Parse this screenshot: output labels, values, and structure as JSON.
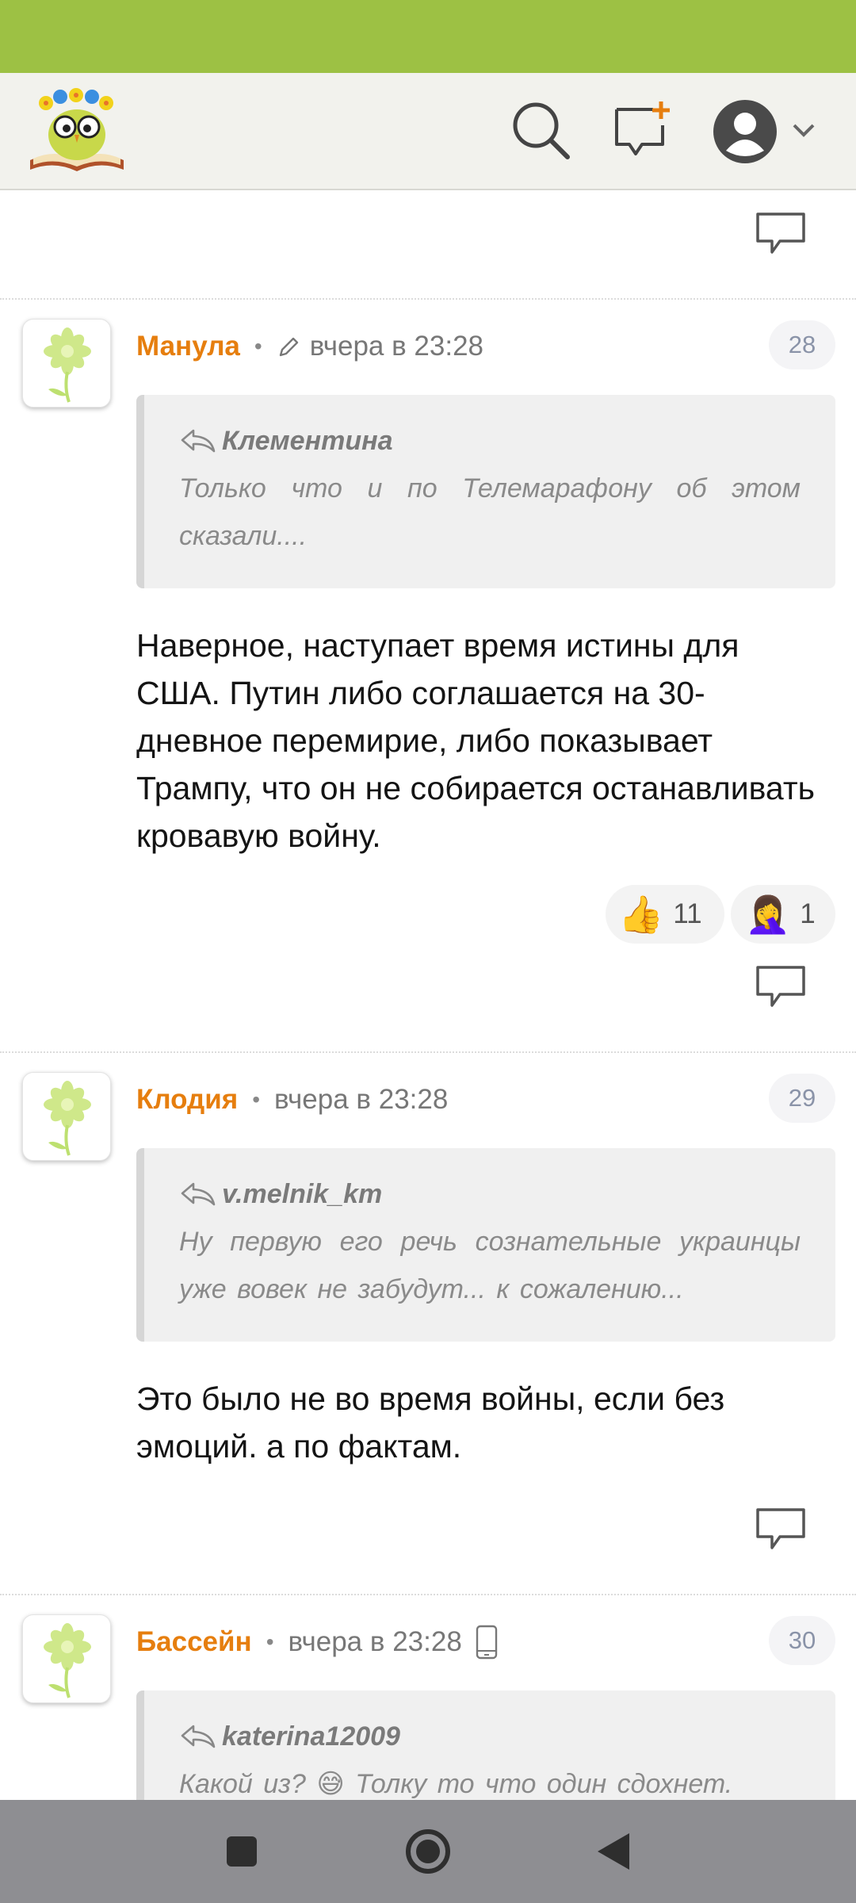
{
  "header": {
    "logo_icon": "reading-owl-logo",
    "search_icon": "search-icon",
    "new_topic_icon": "new-topic-icon",
    "profile_icon": "user-avatar-icon",
    "dropdown_icon": "chevron-down-icon"
  },
  "comments": [
    {
      "author": "Манула",
      "time": "вчера в 23:28",
      "edited_icon": "pencil-icon",
      "number": "28",
      "quote_author": "Клементина",
      "quote_text": "Только что и по Телемарафону об этом сказали....",
      "text": "Наверное, наступает время истины для США. Путин либо соглашается на 30-дневное перемирие, либо показывает Трампу, что он не собирается останавливать кровавую войну.",
      "reactions": [
        {
          "emoji": "👍",
          "count": "11"
        },
        {
          "emoji": "🤦‍♀️",
          "count": "1"
        }
      ]
    },
    {
      "author": "Клодия",
      "time": "вчера в 23:28",
      "number": "29",
      "quote_author": "v.melnik_km",
      "quote_text": "Ну первую его речь сознательные украинцы уже вовек не забудут... к сожалению...",
      "text": "Это было не во время войны, если без эмоций. а по фактам."
    },
    {
      "author": "Бассейн",
      "time": "вчера в 23:28",
      "device_icon": "mobile-phone-icon",
      "number": "30",
      "quote_author": "katerina12009",
      "quote_text": "Какой из? 😅 Толку то что один сдохнет."
    }
  ],
  "nav": {
    "recents_icon": "square-icon",
    "home_icon": "circle-icon",
    "back_icon": "triangle-back-icon"
  },
  "colors": {
    "status_bar": "#9dc144",
    "author": "#e67e0e",
    "header_bg": "#f2f2ed"
  }
}
